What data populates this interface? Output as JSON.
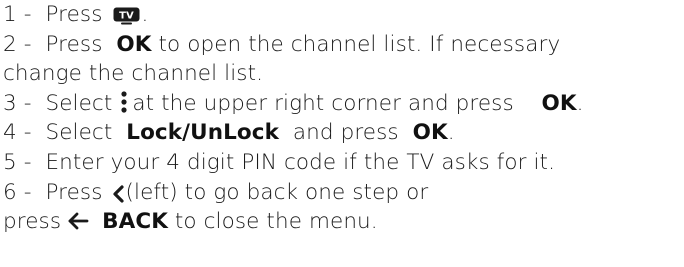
{
  "steps": [
    {
      "num": "1 -",
      "a": "Press",
      "b": "."
    },
    {
      "num": "2 -",
      "a": "Press",
      "kw": "OK",
      "b": "to open the channel list. If necessary",
      "c": "change the channel list."
    },
    {
      "num": "3 -",
      "a": "Select",
      "b": "at the upper right corner and press",
      "kw": "OK",
      "c": "."
    },
    {
      "num": "4 -",
      "a": "Select",
      "kw": "Lock/UnLock",
      "b": "and press",
      "kw2": "OK",
      "c": "."
    },
    {
      "num": "5 -",
      "a": "Enter your 4 digit PIN code if the TV asks for it."
    },
    {
      "num": "6 -",
      "a": "Press",
      "b": "(left) to go back one step or",
      "c": "press",
      "kw": "BACK",
      "d": "to close the menu."
    }
  ],
  "icons": {
    "tv_button": "tv-icon",
    "more_options": "vertical-dots-icon",
    "left": "chevron-left-icon",
    "back": "arrow-left-icon"
  },
  "tv_icon_label": "TV",
  "colors": {
    "text": "#1a1a1a",
    "icon": "#1a1a1a"
  }
}
